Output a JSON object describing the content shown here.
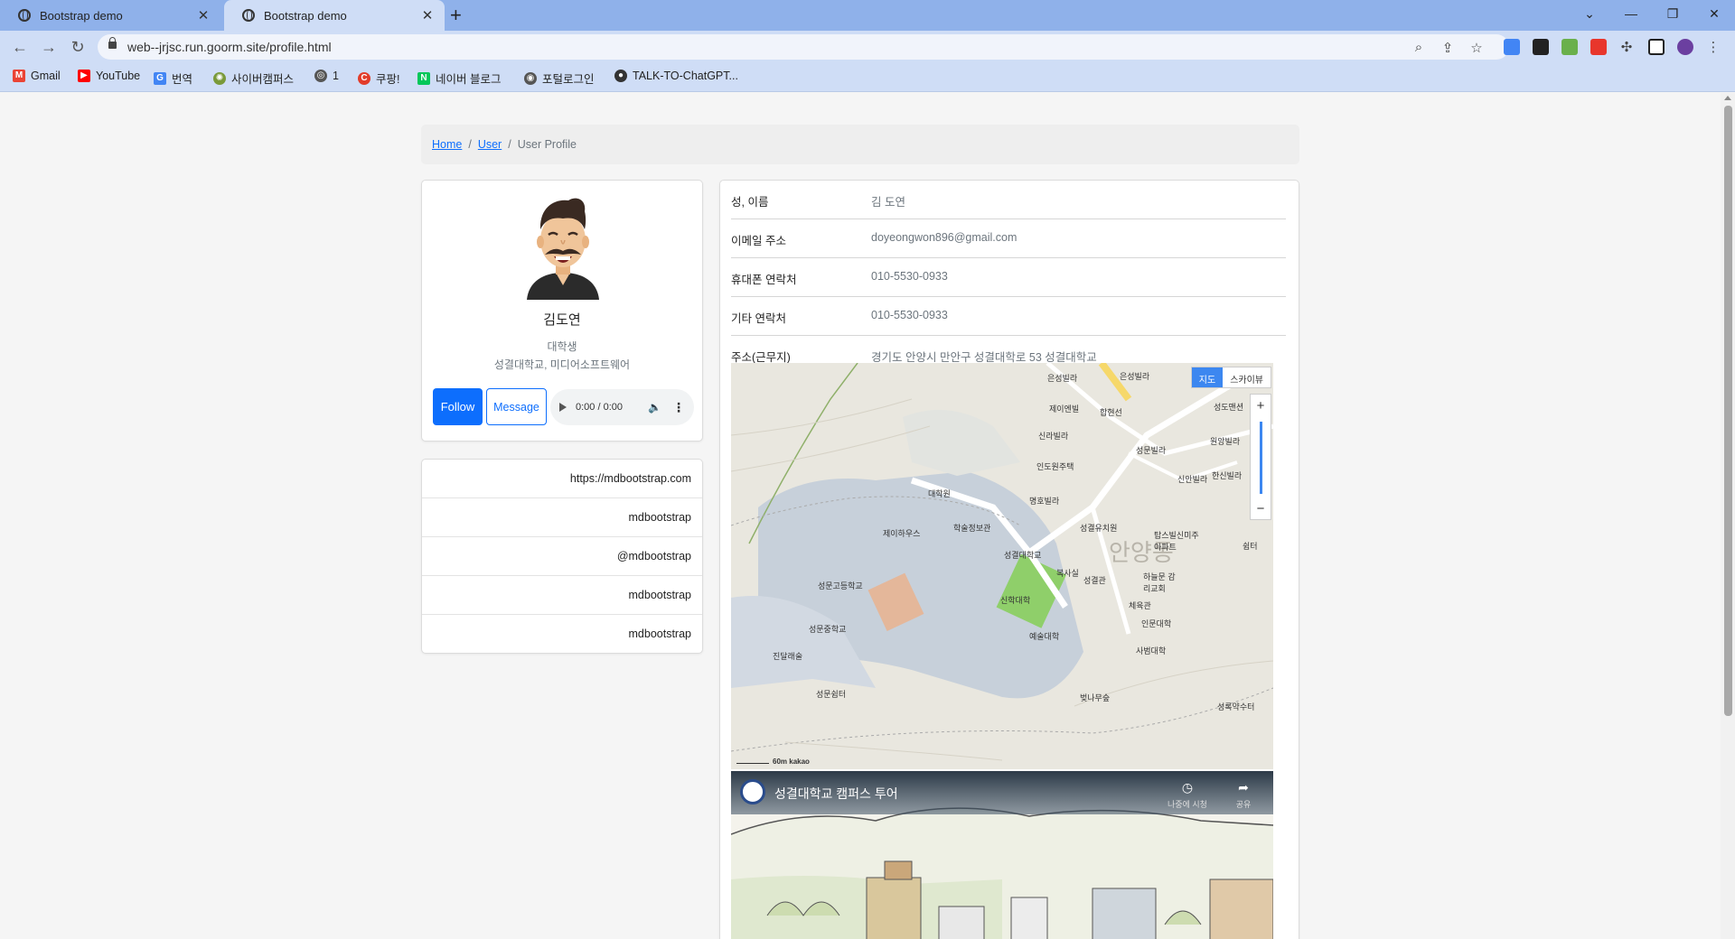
{
  "browser": {
    "tabs": [
      {
        "title": "Bootstrap demo",
        "active": false
      },
      {
        "title": "Bootstrap demo",
        "active": true
      }
    ],
    "url": "web--jrjsc.run.goorm.site/profile.html",
    "bookmarks": [
      {
        "label": "Gmail",
        "icon": "gmail-icon",
        "color": "#ea4335"
      },
      {
        "label": "YouTube",
        "icon": "youtube-icon",
        "color": "#ff0000"
      },
      {
        "label": "번역",
        "icon": "translate-icon",
        "color": "#4285f4"
      },
      {
        "label": "사이버캠퍼스",
        "icon": "campus-icon",
        "color": "#7a9a3a"
      },
      {
        "label": "1",
        "icon": "badge-icon",
        "color": "#555555"
      },
      {
        "label": "쿠팡!",
        "icon": "coupang-icon",
        "color": "#e23c2a"
      },
      {
        "label": "네이버 블로그",
        "icon": "naver-icon",
        "color": "#03c75a"
      },
      {
        "label": "포털로그인",
        "icon": "portal-icon",
        "color": "#555555"
      },
      {
        "label": "TALK-TO-ChatGPT...",
        "icon": "github-icon",
        "color": "#333333"
      }
    ]
  },
  "breadcrumb": {
    "home": "Home",
    "user": "User",
    "current": "User Profile"
  },
  "profile": {
    "name": "김도연",
    "role": "대학생",
    "school": "성결대학교, 미디어소프트웨어",
    "follow_label": "Follow",
    "message_label": "Message",
    "audio_time": "0:00 / 0:00"
  },
  "links": [
    "https://mdbootstrap.com",
    "mdbootstrap",
    "@mdbootstrap",
    "mdbootstrap",
    "mdbootstrap"
  ],
  "info": [
    {
      "label": "성, 이름",
      "value": "김 도연"
    },
    {
      "label": "이메일 주소",
      "value": "doyeongwon896@gmail.com"
    },
    {
      "label": "휴대폰 연락처",
      "value": "010-5530-0933"
    },
    {
      "label": "기타 연락처",
      "value": "010-5530-0933"
    },
    {
      "label": "주소(근무지)",
      "value": "경기도 안양시 만안구 성결대학로 53 성결대학교"
    }
  ],
  "map": {
    "type_map": "지도",
    "type_sky": "스카이뷰",
    "zoom_in": "+",
    "zoom_out": "−",
    "scale": "60m",
    "brand": "kakao",
    "labels": [
      "은성빌라",
      "제이엔빌",
      "합현선",
      "신라빌라",
      "인도원주택",
      "성문빌라",
      "대학원",
      "명호빌라",
      "제이하우스",
      "학술정보관",
      "성결대학교",
      "성결유치원",
      "성문고등학교",
      "복사실",
      "성결관",
      "신학대학",
      "예술대학",
      "하늘문 감리교회",
      "체육관",
      "성문중학교",
      "인문대학",
      "진달래술",
      "사범대학",
      "성문쉼터",
      "벚나무숲",
      "성록약수터",
      "안양동",
      "성도맨션",
      "원앙빌라",
      "신안빌라",
      "한신빌라",
      "탑스빌신미주 아파트",
      "쉼터"
    ]
  },
  "video": {
    "title": "성결대학교 캠퍼스 투어",
    "watch_later": "나중에 시청",
    "share": "공유"
  },
  "colors": {
    "primary": "#0d6efd",
    "tabbar": "#8fb1ea",
    "toolbar": "#cfddf6"
  }
}
